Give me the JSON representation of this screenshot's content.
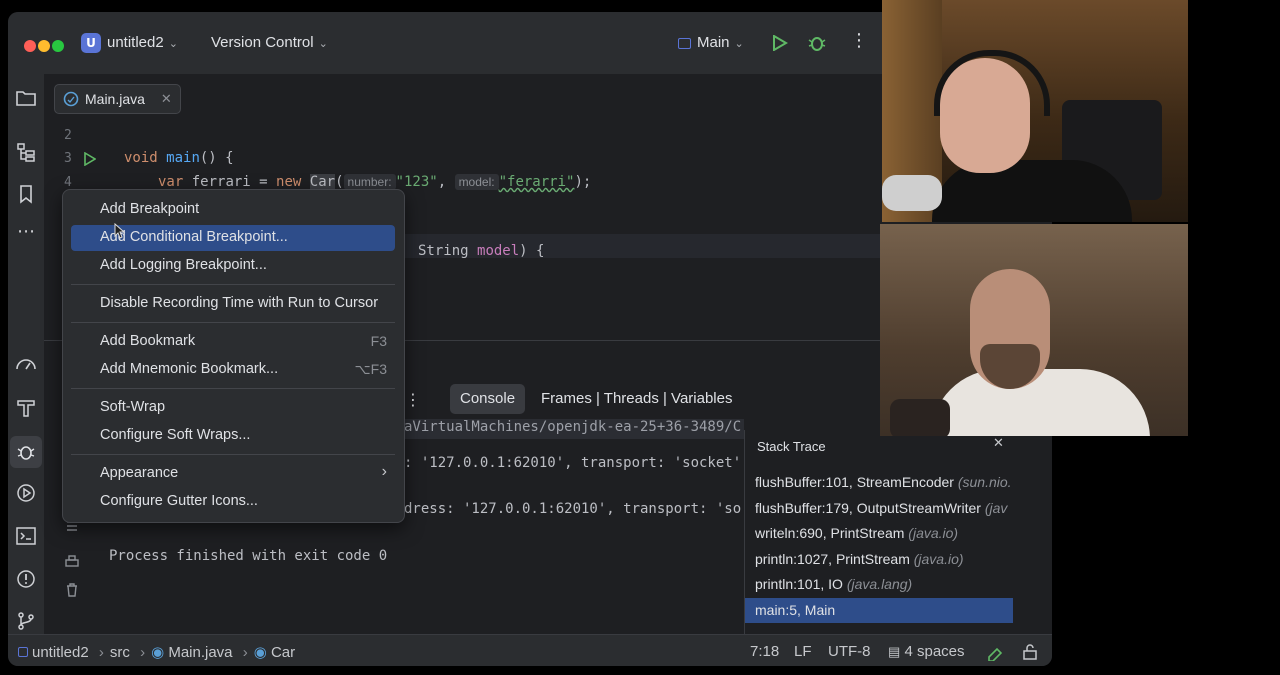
{
  "titlebar": {
    "project_initial": "U",
    "project_name": "untitled2",
    "vcs_label": "Version Control",
    "run_config": "Main"
  },
  "editor": {
    "tab_label": "Main.java",
    "line_numbers": [
      "2",
      "3",
      "4"
    ],
    "line3": {
      "kw": "void",
      "fn": "main",
      "rest": "() {"
    },
    "line4": {
      "kw_var": "var",
      "name": "ferrari",
      "eq": " = ",
      "kw_new": "new",
      "class": "Car",
      "paren": "(",
      "hint1": "number:",
      "str1": "\"123\"",
      "comma": ", ",
      "hint2": "model:",
      "str2": "\"ferarri\"",
      "close": ");"
    },
    "line_ctor": {
      "text": "String ",
      "param": "model",
      "close": ") {"
    }
  },
  "context_menu": {
    "items": [
      {
        "label": "Add Breakpoint",
        "shortcut": ""
      },
      {
        "label": "Add Conditional Breakpoint...",
        "shortcut": ""
      },
      {
        "label": "Add Logging Breakpoint...",
        "shortcut": ""
      },
      {
        "label": "Disable Recording Time with Run to Cursor",
        "shortcut": ""
      },
      {
        "label": "Add Bookmark",
        "shortcut": "F3"
      },
      {
        "label": "Add Mnemonic Bookmark...",
        "shortcut": "⌥F3"
      },
      {
        "label": "Soft-Wrap",
        "shortcut": ""
      },
      {
        "label": "Configure Soft Wraps...",
        "shortcut": ""
      },
      {
        "label": "Appearance",
        "shortcut": "›"
      },
      {
        "label": "Configure Gutter Icons...",
        "shortcut": ""
      }
    ],
    "selected_index": 1
  },
  "debug_panel": {
    "console_tab": "Console",
    "frames_tabs": "Frames | Threads | Variables",
    "console_lines": [
      "aVirtualMachines/openjdk-ea-25+36-3489/C",
      ": '127.0.0.1:62010', transport: 'socket'",
      "dress: '127.0.0.1:62010', transport: 'so",
      "Process finished with exit code 0"
    ],
    "stack_title": "Stack Trace",
    "frames": [
      {
        "method": "flushBuffer:101, StreamEncoder",
        "pkg": "(sun.nio."
      },
      {
        "method": "flushBuffer:179, OutputStreamWriter",
        "pkg": "(jav"
      },
      {
        "method": "writeln:690, PrintStream",
        "pkg": "(java.io)"
      },
      {
        "method": "println:1027, PrintStream",
        "pkg": "(java.io)"
      },
      {
        "method": "println:101, IO",
        "pkg": "(java.lang)"
      },
      {
        "method": "main:5, Main",
        "pkg": ""
      }
    ]
  },
  "statusbar": {
    "crumbs": [
      "untitled2",
      "src",
      "Main.java",
      "Car"
    ],
    "position": "7:18",
    "line_sep": "LF",
    "encoding": "UTF-8",
    "indent": "4 spaces"
  },
  "colors": {
    "accent_selection": "#2e4d8a",
    "bg_editor": "#1e1f22",
    "bg_panel": "#2b2d30"
  }
}
